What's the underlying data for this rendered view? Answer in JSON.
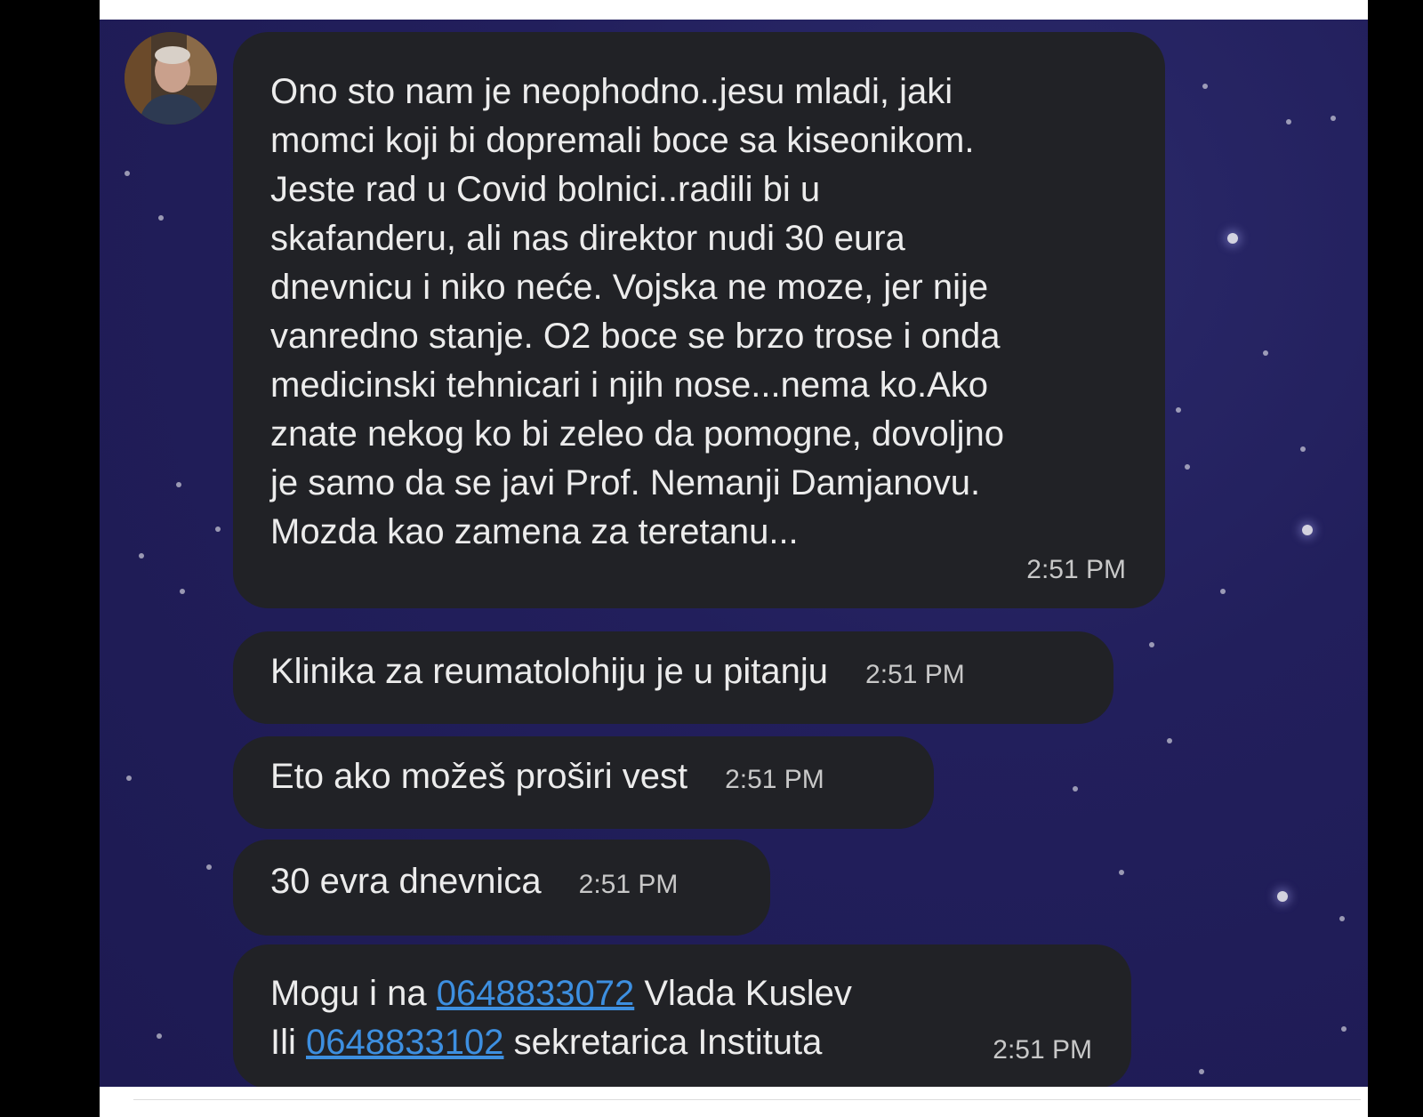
{
  "conversation": {
    "messages": [
      {
        "text": "Ono sto nam je neophodno..jesu mladi, jaki\nmomci koji bi dopremali boce sa kiseonikom.\nJeste rad u Covid bolnici..radili bi u\nskafanderu, ali nas direktor nudi 30 eura\ndnevnicu i niko neće. Vojska ne moze, jer nije\nvanredno stanje. O2 boce se brzo trose i onda\nmedicinski tehnicari i njih nose...nema ko.Ako\nznate nekog ko bi zeleo da pomogne, dovoljno\nje samo da se javi Prof. Nemanji Damjanovu.\nMozda kao zamena za teretanu...",
        "time": "2:51 PM"
      },
      {
        "text": "Klinika za reumatolohiju je u pitanju",
        "time": "2:51 PM"
      },
      {
        "text": "Eto ako možeš proširi vest",
        "time": "2:51 PM"
      },
      {
        "text": "30 evra dnevnica",
        "time": "2:51 PM"
      },
      {
        "line1_prefix": "Mogu i na ",
        "line1_phone": "0648833072",
        "line1_suffix": " Vlada Kuslev",
        "line2_prefix": "Ili ",
        "line2_phone": "0648833102",
        "line2_suffix": " sekretarica Instituta",
        "time": "2:51 PM"
      }
    ]
  },
  "colors": {
    "background": "#1d1a52",
    "bubble": "#212226",
    "text": "#ececec",
    "link": "#3d8fe0"
  },
  "icons": [
    "avatar"
  ]
}
